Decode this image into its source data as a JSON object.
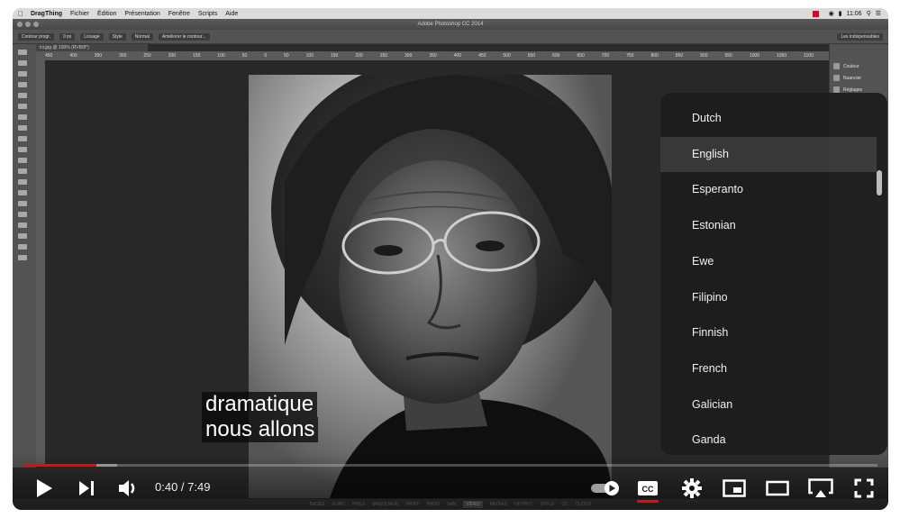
{
  "mac_menubar": {
    "app": "DragThing",
    "items": [
      "Fichier",
      "Édition",
      "Présentation",
      "Fenêtre",
      "Scripts",
      "Aide"
    ],
    "clock": "11:06",
    "status_color": "#c8102e"
  },
  "photoshop": {
    "window_title": "Adobe Photoshop CC 2014",
    "options": {
      "contour_label": "Contour progr.",
      "contour_value": "0 px",
      "lissage": "Lissage",
      "style_label": "Style",
      "style_value": "Normal",
      "refine": "Améliorer le contour...",
      "workspace": "Les indispensables"
    },
    "doc_tab": "Ici.jpg @ 100% (RVB/8*)",
    "ruler_ticks": [
      "450",
      "400",
      "350",
      "300",
      "250",
      "200",
      "150",
      "100",
      "50",
      "0",
      "50",
      "100",
      "150",
      "200",
      "250",
      "300",
      "350",
      "400",
      "450",
      "500",
      "550",
      "600",
      "650",
      "700",
      "750",
      "800",
      "850",
      "900",
      "950",
      "1000",
      "1050",
      "1100",
      "1150",
      "1200"
    ],
    "panel_items": [
      "Couleur",
      "Nuancier",
      "Réglages"
    ],
    "bottom_tabs": [
      "BASES",
      "EURO",
      "PHILS",
      "MASQUAGE",
      "PRINT",
      "PROD",
      "SAN",
      "VIDEO",
      "MEDIAS",
      "OUTPUT",
      "STYLE",
      "CC",
      "CLOUD"
    ],
    "bottom_selected": "VIDEO"
  },
  "captions": [
    "dramatique",
    "nous allons"
  ],
  "language_menu": {
    "items": [
      "Dutch",
      "English",
      "Esperanto",
      "Estonian",
      "Ewe",
      "Filipino",
      "Finnish",
      "French",
      "Galician",
      "Ganda"
    ],
    "selected": "English"
  },
  "player": {
    "time_display": "0:40 / 7:49",
    "progress_played": 0.085,
    "progress_loaded": 0.11,
    "autoplay_on": true,
    "cc_label": "CC",
    "accent_color": "#ff0000"
  }
}
